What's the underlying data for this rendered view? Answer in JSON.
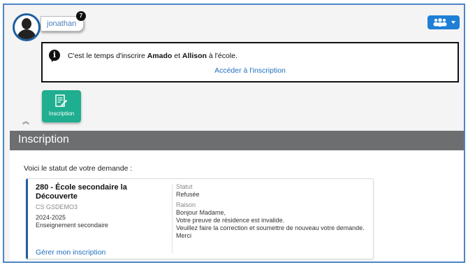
{
  "user": {
    "name": "jonathan",
    "notification_count": "7"
  },
  "alert": {
    "text_before": "C'est le temps d'inscrire ",
    "child1": "Amado",
    "text_mid": " et ",
    "child2": "Allison",
    "text_after": " à l'école.",
    "link_label": "Accéder à l'inscription"
  },
  "tile": {
    "label": "Inscription",
    "icon": "form-edit-icon",
    "color": "#1fae8f"
  },
  "section": {
    "title": "Inscription"
  },
  "status": {
    "intro": "Voici le statut de votre demande :",
    "school_name": "280 - École secondaire la Découverte",
    "code": "CS GSDEMO3",
    "year": "2024-2025",
    "level": "Enseignement secondaire",
    "manage_link": "Gérer mon inscription",
    "status_label": "Statut",
    "status_value": "Refusée",
    "reason_label": "Raison",
    "reason_lines": [
      "Bonjour Madame,",
      "Votre preuve de  résidence est invalide.",
      "Veuillez faire la correction et soumettre de nouveau votre demande.",
      "Merci"
    ]
  },
  "colors": {
    "accent": "#1f7fd6",
    "section_bar": "#6d6e70",
    "link": "#1f6fbf"
  }
}
